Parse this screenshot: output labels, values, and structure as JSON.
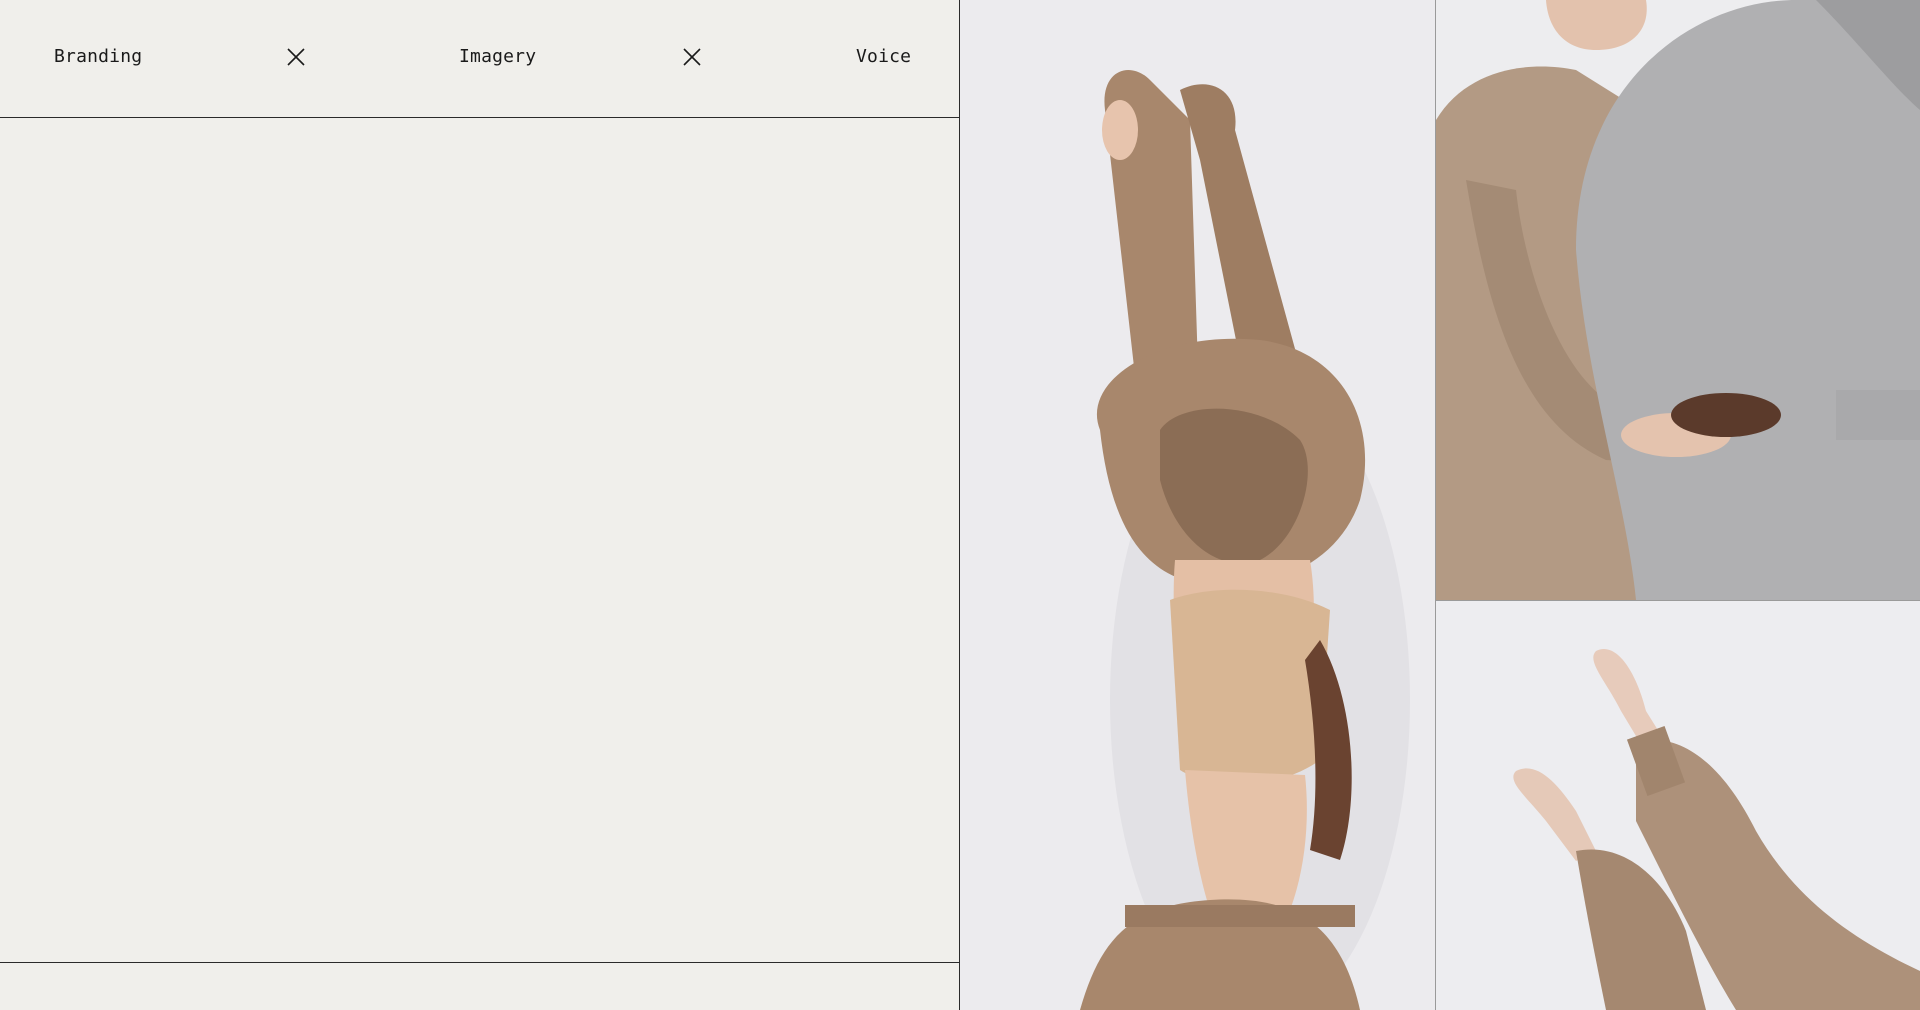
{
  "nav": {
    "items": [
      {
        "label": "Branding"
      },
      {
        "label": "Imagery"
      },
      {
        "label": "Voice"
      }
    ],
    "separator_icon": "close-icon"
  },
  "photos": [
    {
      "subject": "figure-pulling-hoodie-over-head",
      "palette": [
        "#a8876c",
        "#c9ab8c",
        "#ecebee"
      ]
    },
    {
      "subject": "two-people-hugging-hoodies",
      "palette": [
        "#b39a84",
        "#a9a9ab",
        "#ededef"
      ]
    },
    {
      "subject": "raised-hands-sweatshirt-sleeves",
      "palette": [
        "#ad917a",
        "#e5c9b8",
        "#ededf0"
      ]
    }
  ]
}
